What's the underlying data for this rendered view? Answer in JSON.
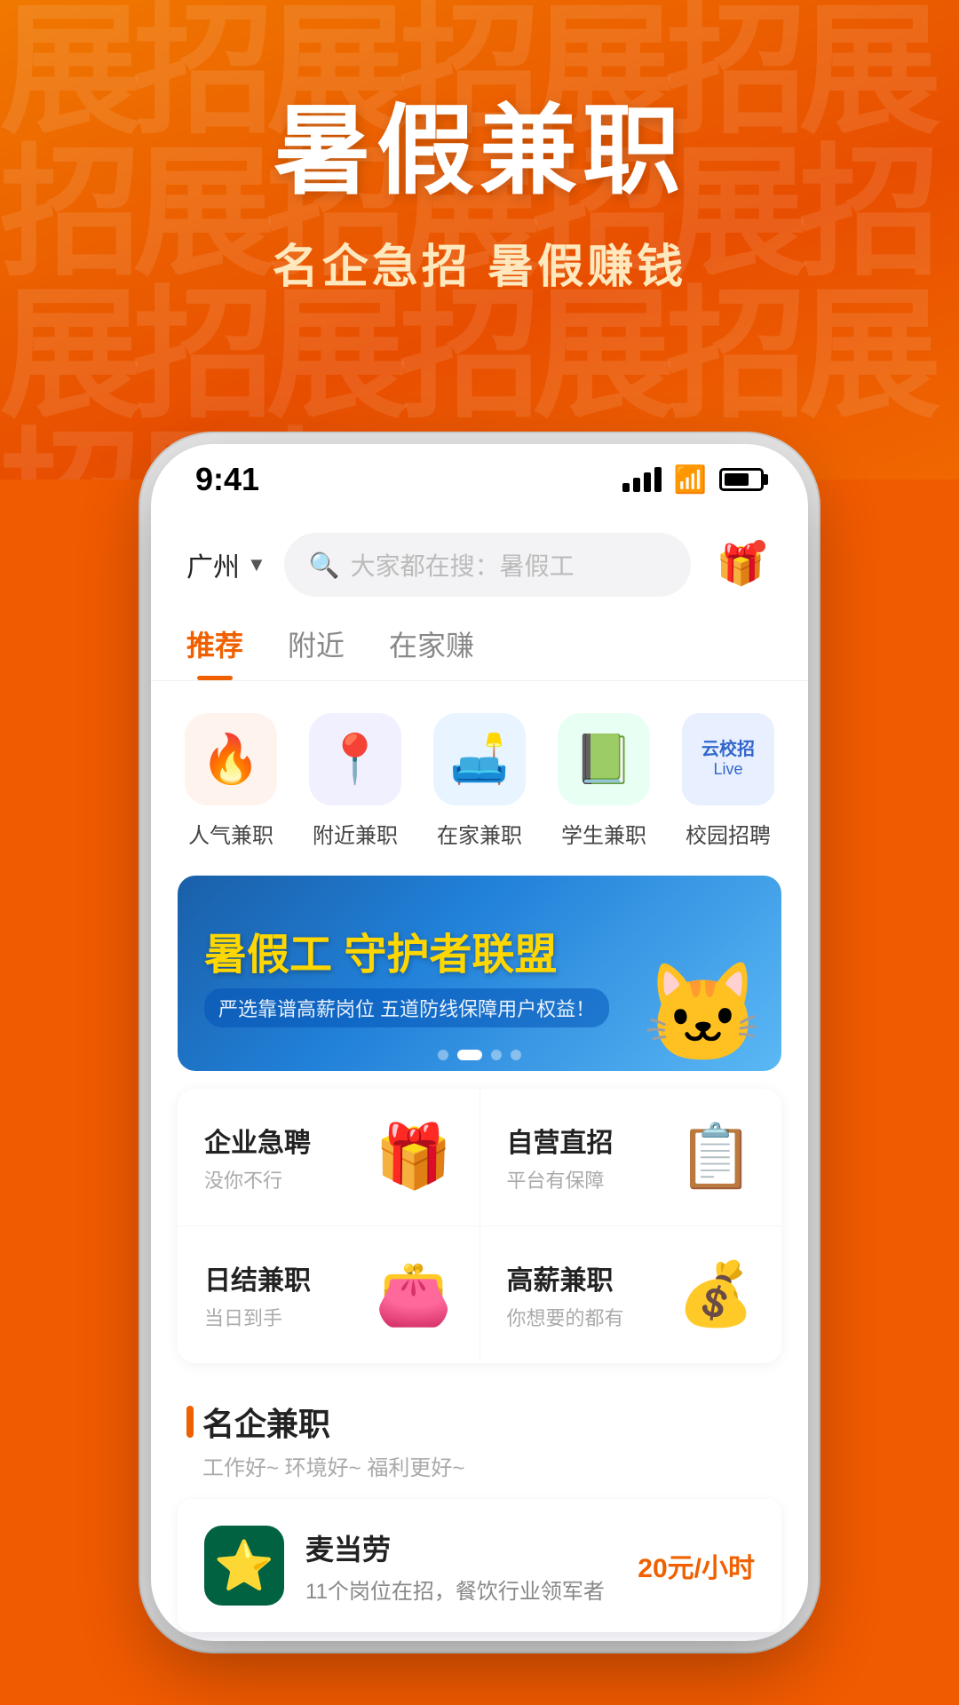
{
  "hero": {
    "title": "暑假兼职",
    "subtitle": "名企急招  暑假赚钱",
    "bg_chars": "展招展招展招展招"
  },
  "status_bar": {
    "time": "9:41"
  },
  "header": {
    "location": "广州",
    "search_placeholder": "大家都在搜：暑假工"
  },
  "nav_tabs": [
    {
      "label": "推荐",
      "active": true
    },
    {
      "label": "附近",
      "active": false
    },
    {
      "label": "在家赚",
      "active": false
    }
  ],
  "categories": [
    {
      "label": "人气兼职",
      "emoji": "🔥"
    },
    {
      "label": "附近兼职",
      "emoji": "📍"
    },
    {
      "label": "在家兼职",
      "emoji": "🛋"
    },
    {
      "label": "学生兼职",
      "emoji": "📗"
    },
    {
      "label": "校园招聘",
      "emoji": "🟦",
      "tag": "云校招\nLive"
    }
  ],
  "banner": {
    "title1": "暑假工",
    "title2": "守护者联盟",
    "subtitle": "严选靠谱高薪岗位 五道防线保障用户权益！",
    "dots": [
      false,
      true,
      false,
      false
    ]
  },
  "quick_links": [
    {
      "row": [
        {
          "name": "企业急聘",
          "desc": "没你不行",
          "emoji": "🎁"
        },
        {
          "name": "自营直招",
          "desc": "平台有保障",
          "emoji": "📋"
        }
      ]
    },
    {
      "row": [
        {
          "name": "日结兼职",
          "desc": "当日到手",
          "emoji": "👛"
        },
        {
          "name": "高薪兼职",
          "desc": "你想要的都有",
          "emoji": "💰"
        }
      ]
    }
  ],
  "famous_section": {
    "title": "名企兼职",
    "subtitle": "工作好~ 环境好~ 福利更好~"
  },
  "job_card": {
    "company_name": "麦当劳",
    "company_logo_emoji": "⭐",
    "salary": "20元/小时",
    "desc": "11个岗位在招，餐饮行业领军者"
  }
}
